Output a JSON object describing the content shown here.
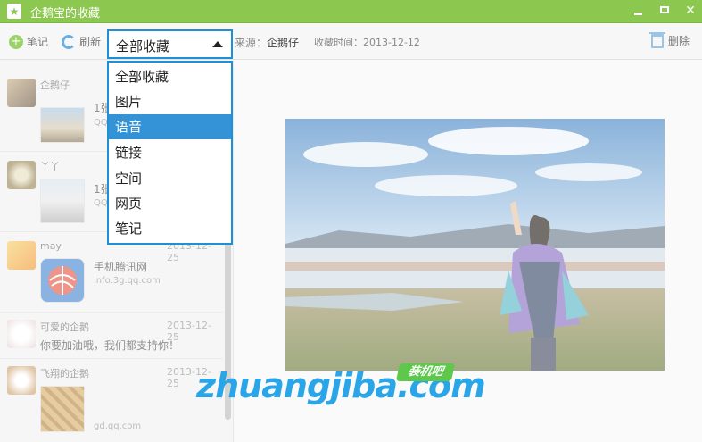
{
  "window": {
    "title": "企鹅宝的收藏"
  },
  "toolbar": {
    "note_label": "笔记",
    "refresh_label": "刷新",
    "filter_selected": "全部收藏",
    "source_label": "来源：",
    "source_value": "企鹅仔",
    "time_label": "收藏时间：",
    "time_value": "2013-12-12",
    "delete_label": "删除"
  },
  "dropdown": {
    "options": [
      "全部收藏",
      "图片",
      "语音",
      "链接",
      "空间",
      "网页",
      "笔记"
    ],
    "highlighted": "语音"
  },
  "list": [
    {
      "user": "企鹅仔",
      "line1": "1张",
      "line2": "QQ",
      "date": ""
    },
    {
      "user": "丫丫",
      "line1": "1张",
      "line2": "QQ",
      "date": ""
    },
    {
      "user": "may",
      "line1": "手机腾讯网",
      "line2": "info.3g.qq.com",
      "date": "2013-12-25"
    },
    {
      "user": "可爱的企鹅",
      "line1": "你要加油哦，我们都支持你！",
      "line2": "",
      "date": "2013-12-25"
    },
    {
      "user": "飞翔的企鹅",
      "line1": "",
      "line2": "gd.qq.com",
      "date": "2013-12-25"
    }
  ],
  "watermark": {
    "text": "zhuangjiba.com",
    "badge": "装机吧"
  },
  "colors": {
    "titlebar": "#8cc74f",
    "accent": "#1e90d6",
    "highlight": "#3493d6"
  }
}
